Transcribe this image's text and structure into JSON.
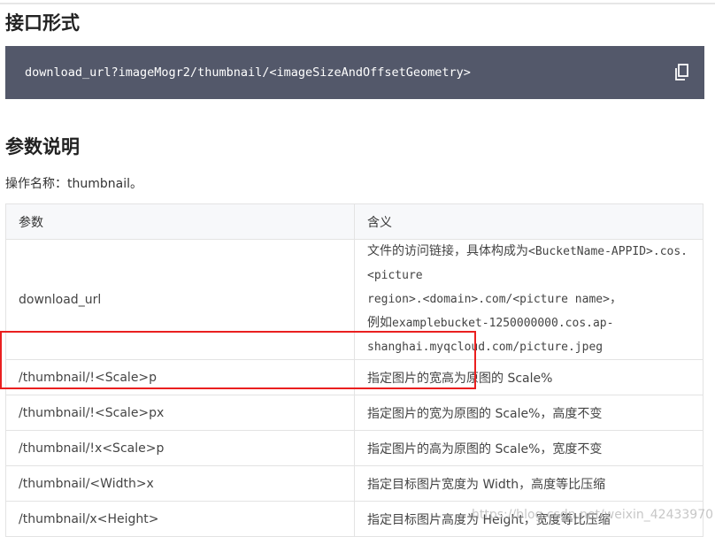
{
  "sections": {
    "interface_title": "接口形式",
    "params_title": "参数说明"
  },
  "code": {
    "text": "download_url?imageMogr2/thumbnail/<imageSizeAndOffsetGeometry>",
    "copy_icon": "copy-icon"
  },
  "operation_name": "操作名称：thumbnail。",
  "table": {
    "headers": [
      "参数",
      "含义"
    ],
    "first_row": {
      "param": "download_url",
      "desc_prefix": "文件的访问链接，具体构成为",
      "desc_code1": "<BucketName-APPID>.cos.<picture",
      "desc_code2": "region>.<domain>.com/<picture name>",
      "desc_sep": "，",
      "desc_example_prefix": "例如",
      "desc_code3": "examplebucket-1250000000.cos.ap-",
      "desc_code4": "shanghai.myqcloud.com/picture.jpeg"
    },
    "rows": [
      {
        "param": "/thumbnail/!<Scale>p",
        "desc": "指定图片的宽高为原图的 Scale%"
      },
      {
        "param": "/thumbnail/!<Scale>px",
        "desc": "指定图片的宽为原图的 Scale%，高度不变"
      },
      {
        "param": "/thumbnail/!x<Scale>p",
        "desc": "指定图片的高为原图的 Scale%，宽度不变"
      },
      {
        "param": "/thumbnail/<Width>x",
        "desc": "指定目标图片宽度为 Width，高度等比压缩"
      },
      {
        "param": "/thumbnail/x<Height>",
        "desc": "指定目标图片高度为 Height，宽度等比压缩"
      }
    ]
  },
  "watermark": "https://blog.csdn.net/weixin_42433970",
  "colors": {
    "code_bg": "#53586a",
    "highlight": "#ea1f1f"
  }
}
